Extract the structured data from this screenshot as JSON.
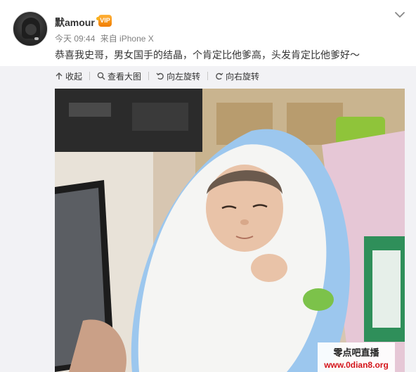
{
  "post": {
    "username": "默amour",
    "badge": "VIP",
    "time": "今天 09:44",
    "source": "来自 iPhone X",
    "text": "恭喜我史哥，男女国手的结晶，个肯定比他爹高，头发肯定比他爹好～"
  },
  "toolbar": {
    "collapse_label": "收起",
    "view_large_label": "查看大图",
    "rotate_left_label": "向左旋转",
    "rotate_right_label": "向右旋转"
  },
  "watermark": {
    "title": "零点吧直播",
    "url": "www.0dian8.org"
  },
  "icons": [
    "chevron-down-icon",
    "arrow-up-icon",
    "magnifier-icon",
    "rotate-left-icon",
    "rotate-right-icon"
  ],
  "colors": {
    "text": "#333333",
    "meta": "#808080",
    "panel_bg": "#f2f2f5",
    "badge": "#f07c00",
    "watermark_url": "#d4141a"
  }
}
